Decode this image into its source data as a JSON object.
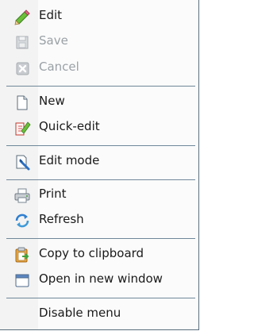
{
  "menu": {
    "items": [
      {
        "label": "Edit",
        "icon": "pencil-icon",
        "enabled": true
      },
      {
        "label": "Save",
        "icon": "save-icon",
        "enabled": false
      },
      {
        "label": "Cancel",
        "icon": "cancel-icon",
        "enabled": false
      },
      {
        "label": "New",
        "icon": "new-page-icon",
        "enabled": true
      },
      {
        "label": "Quick-edit",
        "icon": "quick-edit-icon",
        "enabled": true
      },
      {
        "label": "Edit mode",
        "icon": "edit-mode-icon",
        "enabled": true
      },
      {
        "label": "Print",
        "icon": "printer-icon",
        "enabled": true
      },
      {
        "label": "Refresh",
        "icon": "refresh-icon",
        "enabled": true
      },
      {
        "label": "Copy to clipboard",
        "icon": "clipboard-icon",
        "enabled": true
      },
      {
        "label": "Open in new window",
        "icon": "new-window-icon",
        "enabled": true
      },
      {
        "label": "Disable menu",
        "icon": "",
        "enabled": true
      }
    ]
  },
  "colors": {
    "separator": "#6f8799",
    "border": "#5b6f7d",
    "disabled_text": "#9aa1a6"
  }
}
